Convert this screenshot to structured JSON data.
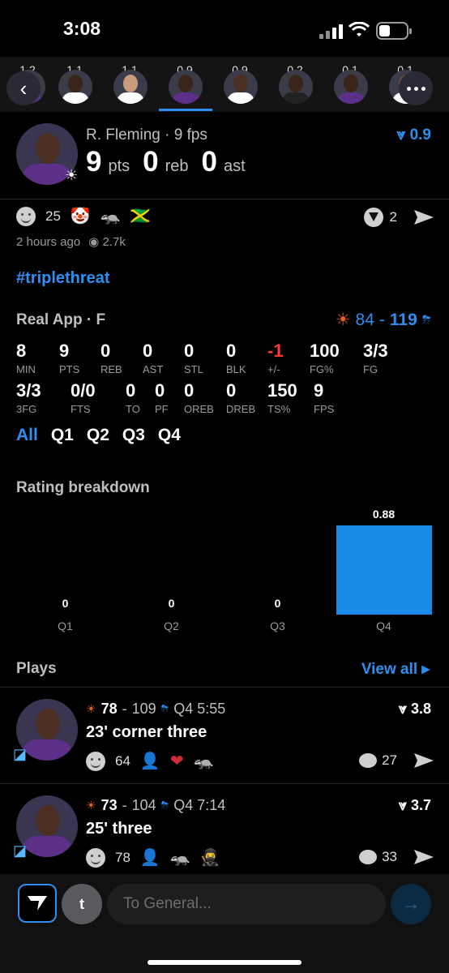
{
  "status_bar": {
    "time": "3:08"
  },
  "strip": {
    "players": [
      {
        "value": "1.2",
        "name": "player-1"
      },
      {
        "value": "1.1",
        "name": "player-2"
      },
      {
        "value": "1.1",
        "name": "player-3"
      },
      {
        "value": "0.9",
        "name": "player-4"
      },
      {
        "value": "0.9",
        "name": "player-5"
      },
      {
        "value": "0.2",
        "name": "player-6"
      },
      {
        "value": "0.1",
        "name": "player-7"
      },
      {
        "value": "0.1",
        "name": "player-8"
      }
    ]
  },
  "header": {
    "name": "R. Fleming · 9 fps",
    "pts": "9",
    "pts_label": "pts",
    "reb": "0",
    "reb_label": "reb",
    "ast": "0",
    "ast_label": "ast",
    "rating": "0.9"
  },
  "reactions": {
    "count": "25",
    "emojis": [
      "🤡",
      "🦡",
      "🇯🇲"
    ],
    "v_count": "2"
  },
  "meta": {
    "time_ago": "2 hours ago",
    "views": "2.7k"
  },
  "hashtag": "#triplethreat",
  "box": {
    "title": "Real App · F",
    "score_team1": "84",
    "score_sep": "-",
    "score_team2": "119",
    "row1": [
      {
        "v": "8",
        "l": "MIN"
      },
      {
        "v": "9",
        "l": "PTS"
      },
      {
        "v": "0",
        "l": "REB"
      },
      {
        "v": "0",
        "l": "AST"
      },
      {
        "v": "0",
        "l": "STL"
      },
      {
        "v": "0",
        "l": "BLK"
      },
      {
        "v": "-1",
        "l": "+/-"
      },
      {
        "v": "100",
        "l": "FG%"
      },
      {
        "v": "3/3",
        "l": "FG"
      }
    ],
    "row2": [
      {
        "v": "3/3",
        "l": "3FG"
      },
      {
        "v": "0/0",
        "l": "FTS"
      },
      {
        "v": "0",
        "l": "TO"
      },
      {
        "v": "0",
        "l": "PF"
      },
      {
        "v": "0",
        "l": "OREB"
      },
      {
        "v": "0",
        "l": "DREB"
      },
      {
        "v": "150",
        "l": "TS%"
      },
      {
        "v": "9",
        "l": "FPS"
      }
    ]
  },
  "quarter_tabs": [
    "All",
    "Q1",
    "Q2",
    "Q3",
    "Q4"
  ],
  "chart_data": {
    "type": "bar",
    "title": "Rating breakdown",
    "categories": [
      "Q1",
      "Q2",
      "Q3",
      "Q4"
    ],
    "values": [
      0,
      0,
      0,
      0.88
    ],
    "value_labels": [
      "0",
      "0",
      "0",
      "0.88"
    ],
    "ylim": [
      0,
      0.88
    ],
    "color": "#1a8be6"
  },
  "plays": {
    "title": "Plays",
    "view_all": "View all",
    "items": [
      {
        "score_a": "78",
        "score_b": "109",
        "clock": "Q4 5:55",
        "desc": "23' corner three",
        "rating": "3.8",
        "react_count": "64",
        "comment_count": "27"
      },
      {
        "score_a": "73",
        "score_b": "104",
        "clock": "Q4 7:14",
        "desc": "25' three",
        "rating": "3.7",
        "react_count": "78",
        "comment_count": "33"
      }
    ]
  },
  "composer": {
    "avatar_letter": "t",
    "placeholder": "To General..."
  },
  "colors": {
    "accent": "#2e8ff0",
    "negative": "#ff3b30",
    "bar": "#1a8be6"
  }
}
